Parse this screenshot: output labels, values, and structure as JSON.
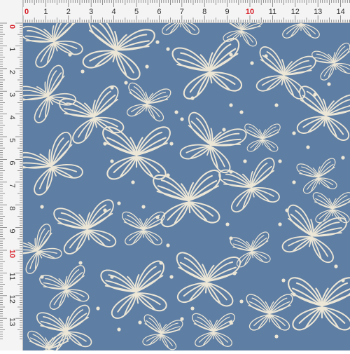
{
  "fabric": {
    "background_color": "#5f7ea3",
    "print_color": "#ece6d6",
    "motif": "butterfly-outline",
    "accent_motif": "dot"
  },
  "ruler": {
    "background_color": "#f4f4f4",
    "tick_color": "#7a7a7a",
    "label_color": "#333333",
    "highlight_color": "#d8202a",
    "top_labels": [
      "0",
      "1",
      "2",
      "3",
      "4",
      "5",
      "6",
      "7",
      "8",
      "9",
      "10",
      "11",
      "12",
      "13",
      "14"
    ],
    "left_labels": [
      "0",
      "1",
      "2",
      "3",
      "4",
      "5",
      "6",
      "7",
      "8",
      "9",
      "10",
      "11",
      "12",
      "13"
    ],
    "highlight_labels": [
      "0",
      "10"
    ]
  }
}
